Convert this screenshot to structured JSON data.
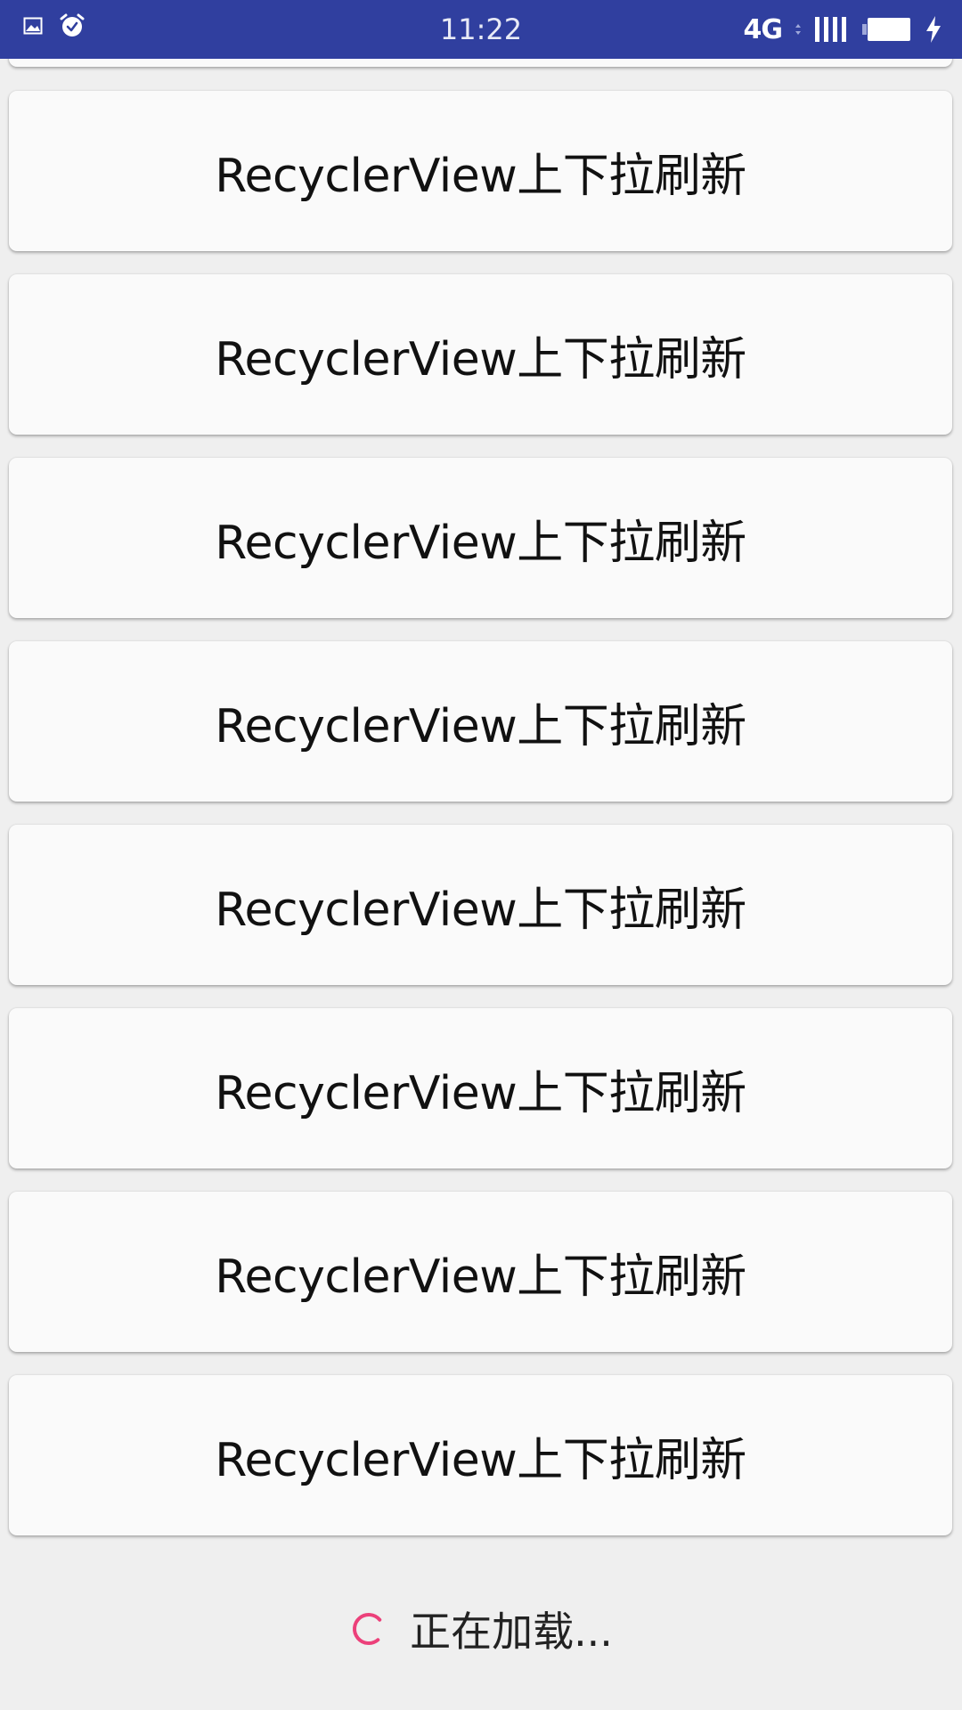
{
  "status_bar": {
    "time": "11:22",
    "network": "4G",
    "icons": [
      "image-icon",
      "alarm-icon",
      "signal-icon",
      "battery-icon",
      "charging-icon"
    ],
    "color": "#303f9f"
  },
  "list": {
    "items": [
      {
        "label": "RecyclerView上下拉刷新"
      },
      {
        "label": "RecyclerView上下拉刷新"
      },
      {
        "label": "RecyclerView上下拉刷新"
      },
      {
        "label": "RecyclerView上下拉刷新"
      },
      {
        "label": "RecyclerView上下拉刷新"
      },
      {
        "label": "RecyclerView上下拉刷新"
      },
      {
        "label": "RecyclerView上下拉刷新"
      },
      {
        "label": "RecyclerView上下拉刷新"
      }
    ]
  },
  "footer": {
    "loading_text": "正在加载...",
    "spinner_color": "#ec407a"
  }
}
